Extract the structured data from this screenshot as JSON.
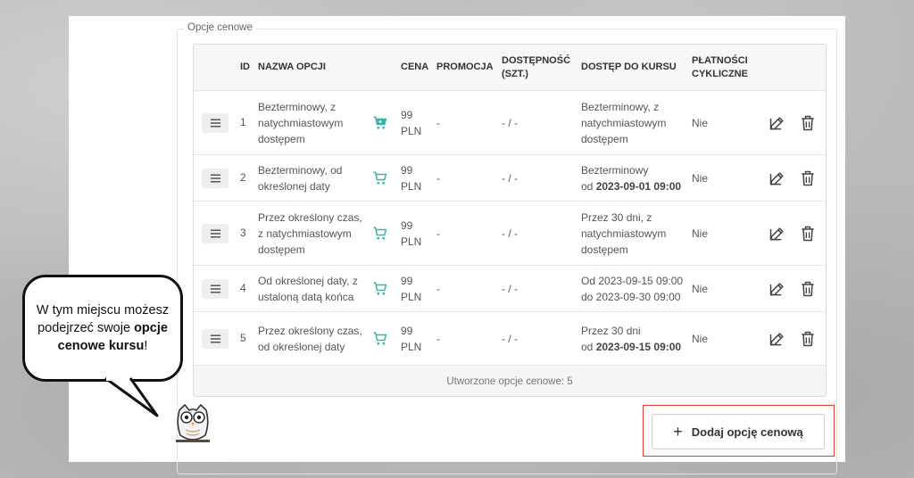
{
  "section": {
    "legend": "Opcje cenowe"
  },
  "columns": {
    "id": "ID",
    "name": "NAZWA OPCJI",
    "price": "CENA",
    "promo": "PROMOCJA",
    "availability": [
      "DOSTĘPNOŚĆ",
      "(SZT.)"
    ],
    "access": "DOSTĘP DO KURSU",
    "recurring": [
      "PŁATNOŚCI",
      "CYKLICZNE"
    ]
  },
  "rows": [
    {
      "id": "1",
      "name": [
        "Bezterminowy, z",
        "natychmiastowym",
        "dostępem"
      ],
      "price": [
        "99",
        "PLN"
      ],
      "promo": "-",
      "availability": "- / -",
      "access": [
        [
          "Bezterminowy, z",
          ""
        ],
        [
          "natychmiastowym",
          ""
        ],
        [
          "dostępem",
          ""
        ]
      ],
      "recurring": "Nie",
      "cart_filled": true
    },
    {
      "id": "2",
      "name": [
        "Bezterminowy, od",
        "określonej daty"
      ],
      "price": [
        "99",
        "PLN"
      ],
      "promo": "-",
      "availability": "- / -",
      "access": [
        [
          "Bezterminowy",
          ""
        ],
        [
          "od ",
          "2023-09-01 09:00"
        ]
      ],
      "recurring": "Nie",
      "cart_filled": false
    },
    {
      "id": "3",
      "name": [
        "Przez określony czas,",
        "z natychmiastowym",
        "dostępem"
      ],
      "price": [
        "99",
        "PLN"
      ],
      "promo": "-",
      "availability": "- / -",
      "access": [
        [
          "Przez 30 dni, z",
          ""
        ],
        [
          "natychmiastowym",
          ""
        ],
        [
          "dostępem",
          ""
        ]
      ],
      "recurring": "Nie",
      "cart_filled": false
    },
    {
      "id": "4",
      "name": [
        "Od określonej daty, z",
        "ustaloną datą końca"
      ],
      "price": [
        "99",
        "PLN"
      ],
      "promo": "-",
      "availability": "- / -",
      "access": [
        [
          "Od 2023-09-15 09:00",
          ""
        ],
        [
          "do 2023-09-30 09:00",
          ""
        ]
      ],
      "recurring": "Nie",
      "cart_filled": false
    },
    {
      "id": "5",
      "name": [
        "Przez określony czas,",
        "od określonej daty"
      ],
      "price": [
        "99",
        "PLN"
      ],
      "promo": "-",
      "availability": "- / -",
      "access": [
        [
          "Przez 30 dni",
          ""
        ],
        [
          "od ",
          "2023-09-15 09:00"
        ]
      ],
      "recurring": "Nie",
      "cart_filled": false
    }
  ],
  "footer": {
    "count_text": "Utworzone opcje cenowe: 5"
  },
  "add_button": {
    "icon": "+",
    "label": "Dodaj opcję cenową"
  },
  "callout": {
    "part1": "W tym miejscu możesz podejrzeć swoje ",
    "bold": "opcje cenowe kursu",
    "part2": "!"
  },
  "colors": {
    "accent": "#2fb8a8",
    "highlight_frame": "#e53935"
  },
  "icons": {
    "drag": "drag-handle-icon",
    "cart": "cart-icon",
    "edit": "edit-icon",
    "delete": "trash-icon",
    "mascot": "owl-icon"
  }
}
